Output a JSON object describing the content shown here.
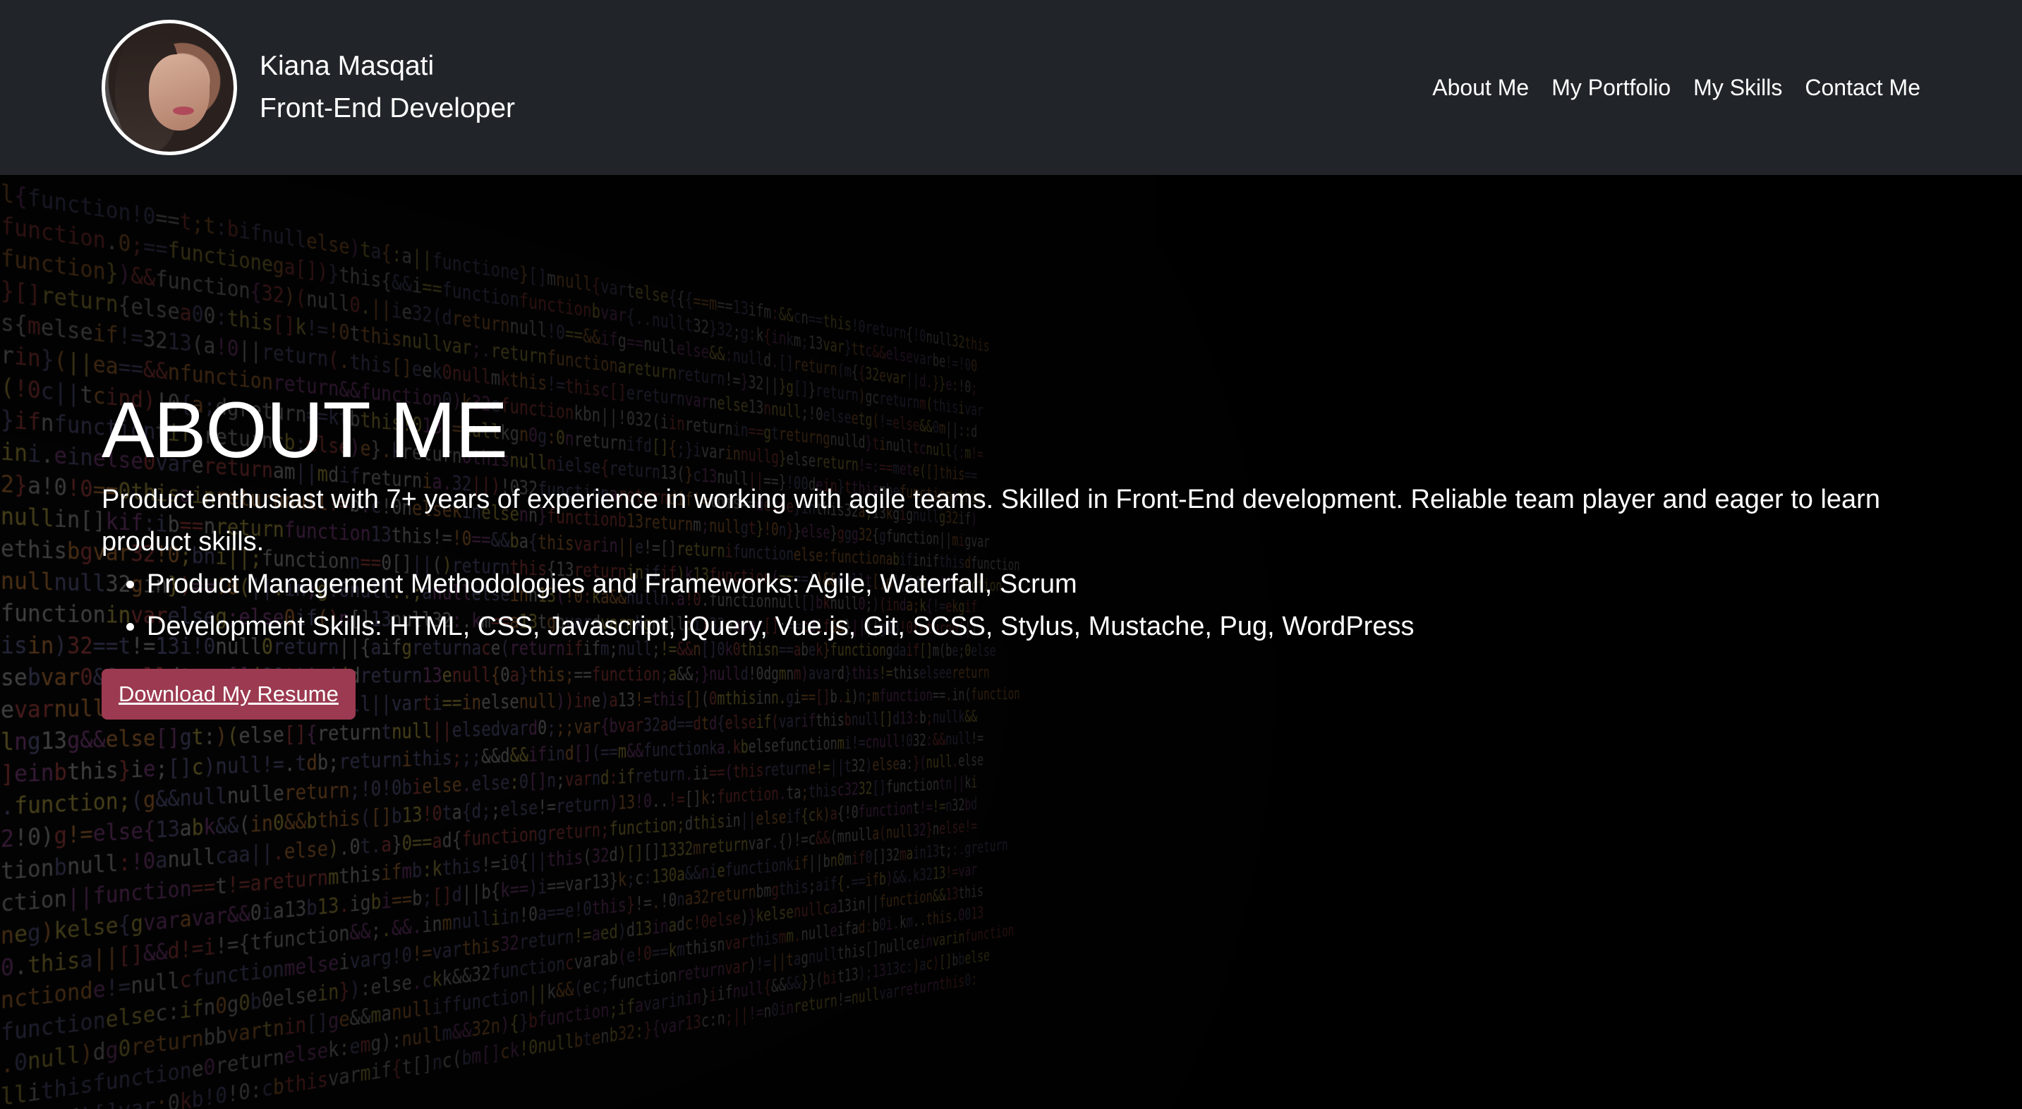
{
  "header": {
    "name": "Kiana Masqati",
    "role": "Front-End Developer",
    "nav": [
      {
        "label": "About Me"
      },
      {
        "label": "My Portfolio"
      },
      {
        "label": "My Skills"
      },
      {
        "label": "Contact Me"
      }
    ]
  },
  "about": {
    "title": "ABOUT ME",
    "description": "Product enthusiast with 7+ years of experience in working with agile teams. Skilled in Front-End development. Reliable team player and eager to learn product skills.",
    "skills": [
      "Product Management Methodologies and Frameworks: Agile, Waterfall, Scrum",
      "Development Skills: HTML, CSS, Javascript, jQuery, Vue.js, Git, SCSS, Stylus, Mustache, Pug, WordPress"
    ],
    "button_label": "Download My Resume"
  },
  "colors": {
    "navbar_bg": "#212529",
    "button_bg": "#9b3a50"
  }
}
